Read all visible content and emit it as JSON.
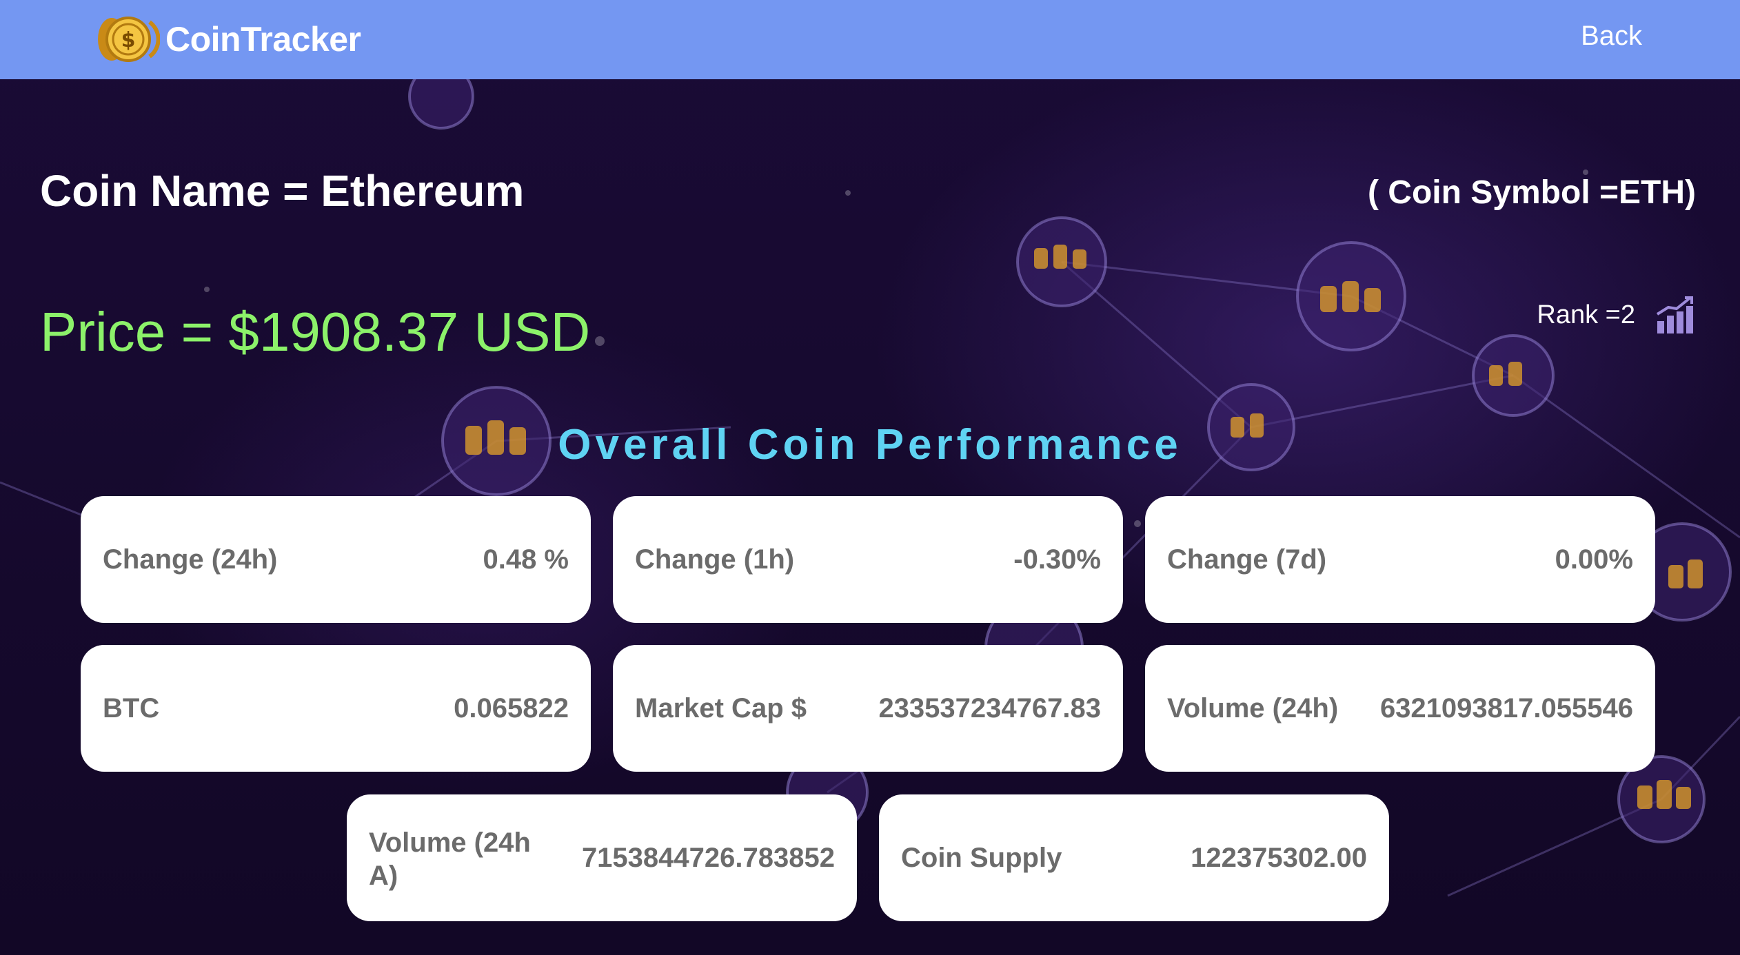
{
  "navbar": {
    "brand": "CoinTracker",
    "logo_icon": "dollar-coin-icon",
    "back_label": "Back",
    "color": "#7497f2"
  },
  "coin": {
    "name_line": "Coin Name = Ethereum",
    "symbol_line": "( Coin Symbol =ETH)",
    "price_line": "Price = $1908.37 USD",
    "rank_line": "Rank =2",
    "rank_icon": "bar-chart-up-icon"
  },
  "section_title": "Overall Coin Performance",
  "colors": {
    "price": "#8cf26a",
    "section_title": "#5fd3f3",
    "card_text": "#6b6b6b"
  },
  "cards": [
    {
      "label": "Change (24h)",
      "value": "0.48 %"
    },
    {
      "label": "Change (1h)",
      "value": "-0.30%"
    },
    {
      "label": "Change (7d)",
      "value": "0.00%"
    },
    {
      "label": "BTC",
      "value": "0.065822"
    },
    {
      "label": "Market Cap $",
      "value": "233537234767.83"
    },
    {
      "label": "Volume (24h)",
      "value": "6321093817.055546"
    },
    {
      "label": "Volume (24h A)",
      "value": "7153844726.783852"
    },
    {
      "label": "Coin Supply",
      "value": "122375302.00"
    }
  ]
}
